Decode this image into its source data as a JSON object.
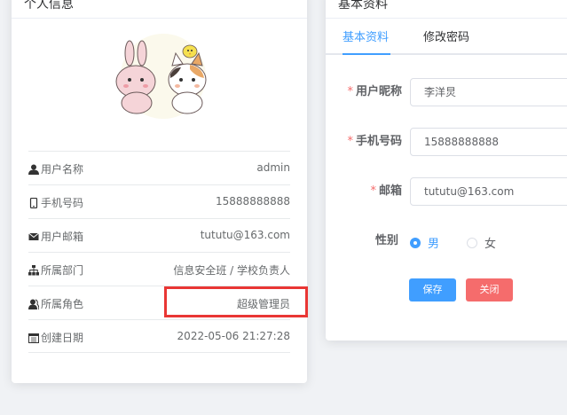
{
  "left_card": {
    "title": "个人信息",
    "rows": [
      {
        "label": "用户名称",
        "value": "admin",
        "icon": "user-icon"
      },
      {
        "label": "手机号码",
        "value": "15888888888",
        "icon": "phone-icon"
      },
      {
        "label": "用户邮箱",
        "value": "tututu@163.com",
        "icon": "email-icon"
      },
      {
        "label": "所属部门",
        "value": "信息安全班 / 学校负责人",
        "icon": "tree-icon"
      },
      {
        "label": "所属角色",
        "value": "超级管理员",
        "icon": "peoples-icon"
      },
      {
        "label": "创建日期",
        "value": "2022-05-06 21:27:28",
        "icon": "date-icon"
      }
    ]
  },
  "right_card": {
    "title": "基本资料",
    "tabs": [
      {
        "label": "基本资料",
        "active": true
      },
      {
        "label": "修改密码",
        "active": false
      }
    ],
    "form": {
      "nickname": {
        "required": "*",
        "label": "用户昵称",
        "value": "李洋炅"
      },
      "phone": {
        "required": "*",
        "label": "手机号码",
        "value": "15888888888"
      },
      "email": {
        "required": "*",
        "label": "邮箱",
        "value": "tututu@163.com"
      },
      "gender": {
        "label": "性别",
        "options": [
          "男",
          "女"
        ],
        "selected": "男"
      },
      "save_label": "保存",
      "close_label": "关闭"
    }
  },
  "colors": {
    "primary": "#409eff",
    "danger": "#f56c6c",
    "highlight": "#e93634"
  }
}
